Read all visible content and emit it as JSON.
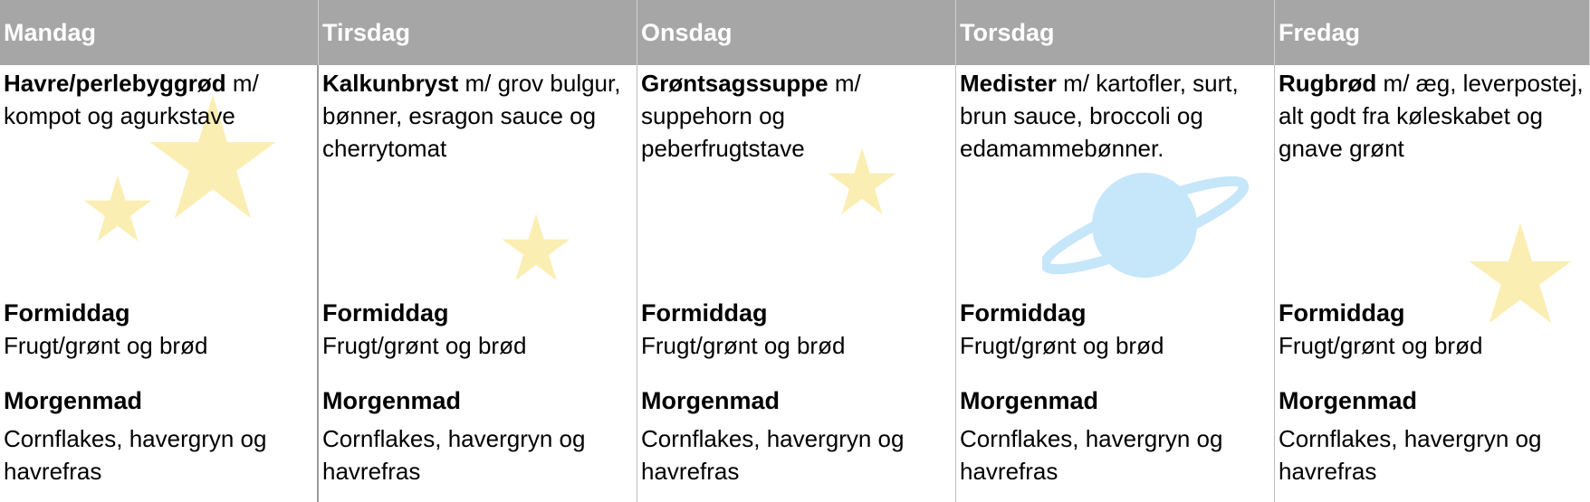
{
  "days": [
    {
      "name": "Mandag",
      "lunch_main": "Havre/perlebyggrød",
      "lunch_rest": " m/ kompot og agurkstave",
      "formiddag_title": "Formiddag",
      "formiddag_text": "Frugt/grønt og brød",
      "morgenmad_title": "Morgenmad",
      "morgenmad_text": "Cornflakes, havergryn og havrefras"
    },
    {
      "name": "Tirsdag",
      "lunch_main": "Kalkunbryst",
      "lunch_rest": " m/ grov bulgur, bønner, esragon sauce og cherrytomat",
      "formiddag_title": "Formiddag",
      "formiddag_text": "Frugt/grønt og brød",
      "morgenmad_title": "Morgenmad",
      "morgenmad_text": "Cornflakes, havergryn og havrefras"
    },
    {
      "name": "Onsdag",
      "lunch_main": "Grøntsagssuppe",
      "lunch_rest": " m/ suppehorn og peberfrugtstave",
      "formiddag_title": "Formiddag",
      "formiddag_text": "Frugt/grønt og brød",
      "morgenmad_title": "Morgenmad",
      "morgenmad_text": "Cornflakes, havergryn og havrefras"
    },
    {
      "name": "Torsdag",
      "lunch_main": "Medister",
      "lunch_rest": " m/ kartofler, surt, brun sauce, broccoli og edamammebønner.",
      "formiddag_title": "Formiddag",
      "formiddag_text": "Frugt/grønt og brød",
      "morgenmad_title": "Morgenmad",
      "morgenmad_text": "Cornflakes, havergryn og havrefras"
    },
    {
      "name": "Fredag",
      "lunch_main": "Rugbrød",
      "lunch_rest": " m/ æg, leverpostej, alt godt fra køleskabet og gnave grønt",
      "formiddag_title": "Formiddag",
      "formiddag_text": "Frugt/grønt og brød",
      "morgenmad_title": "Morgenmad",
      "morgenmad_text": "Cornflakes, havergryn og havrefras"
    }
  ],
  "colors": {
    "header_bg": "#a6a6a6",
    "header_text": "#ffffff",
    "star": "#fbeeb3",
    "planet": "#c6e6fa"
  }
}
